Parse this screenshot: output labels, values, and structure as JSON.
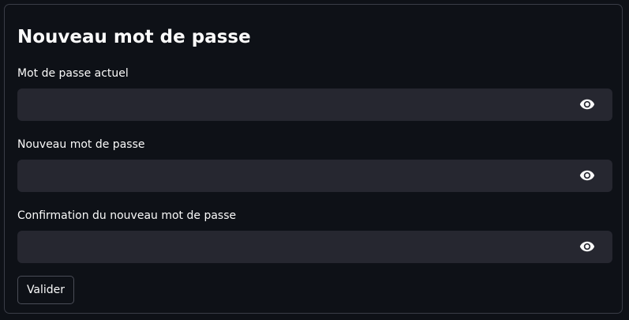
{
  "form": {
    "title": "Nouveau mot de passe",
    "fields": [
      {
        "label": "Mot de passe actuel",
        "value": "",
        "icon": "eye-icon"
      },
      {
        "label": "Nouveau mot de passe",
        "value": "",
        "icon": "eye-icon"
      },
      {
        "label": "Confirmation du nouveau mot de passe",
        "value": "",
        "icon": "eye-icon"
      }
    ],
    "submit_label": "Valider"
  },
  "colors": {
    "background": "#0e1117",
    "input_background": "#262730",
    "border": "#3a3d47",
    "text": "#fafafa"
  }
}
